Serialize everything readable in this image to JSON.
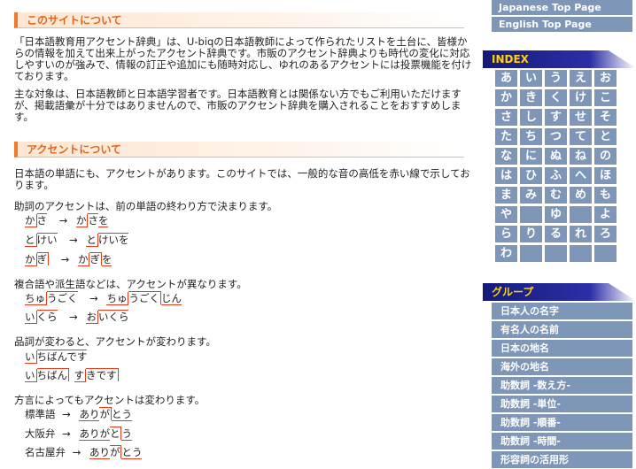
{
  "sections": {
    "about_title": "このサイトについて",
    "about_p1": "「日本語教育用アクセント辞典」は、U-biqの日本語教師によって作られたリストを土台に、皆様からの情報を加えて出来上がったアクセント辞典です。市販のアクセント辞典よりも時代の変化に対応しやすいのが強みで、情報の訂正や追加にも随時対応し、ゆれのあるアクセントには投票機能を付けております。",
    "about_p2": "主な対象は、日本語教師と日本語学習者です。日本語教育とは関係ない方でもご利用いただけますが、掲載語彙が十分ではありませんので、市販のアクセント辞典を購入されることをおすすめします。",
    "accent_title": "アクセントについて",
    "accent_p1": "日本語の単語にも、アクセントがあります。このサイトでは、一般的な音の高低を赤い線で示しております。",
    "particle_intro": "助詞のアクセントは、前の単語の終わり方で決まります。",
    "particle_examples": [
      {
        "a1": "か",
        "a2": "さ",
        "arrow": "→",
        "b1": "か",
        "b2": "さ",
        "b3": "を"
      },
      {
        "a1": "と",
        "a2": "けい",
        "arrow": "→",
        "b1": "と",
        "b2": "けい",
        "b3": "を"
      },
      {
        "a1": "か",
        "a2": "ぎ",
        "arrow": "→",
        "b1": "か",
        "b2": "ぎ",
        "b3": "を"
      }
    ],
    "compound_intro": "複合語や派生語などは、アクセントが異なります。",
    "compound_examples": [
      {
        "a1": "ちゅ",
        "a2": "うごく",
        "arrow": "→",
        "b1": "ちゅ",
        "b2": "うごく",
        "b3": "じん"
      },
      {
        "a1": "い",
        "a2": "くら",
        "arrow": "→",
        "b1": "お",
        "b2": "いくら",
        "b3": ""
      }
    ],
    "pos_intro": "品詞が変わると、アクセントが変わります。",
    "pos_examples": [
      {
        "a1": "い",
        "a2": "ちばんです"
      },
      {
        "a1": "い",
        "a2": "ちばん",
        "a3": "す",
        "a4": "きです"
      }
    ],
    "dialect_intro": "方言によってもアクセントは変わります。",
    "dialect_examples": [
      {
        "label": "標準語",
        "arrow": "→",
        "w1": "あり",
        "w2": "が",
        "w3": "とう"
      },
      {
        "label": "大阪弁",
        "arrow": "→",
        "w1": "ありが",
        "w2": "と",
        "w3": "う"
      },
      {
        "label": "名古屋弁",
        "arrow": "→",
        "w1": "あり",
        "w2": "が",
        "w3": "とう"
      }
    ]
  },
  "sidebar": {
    "links": [
      "Japanese Top Page",
      "English Top Page"
    ],
    "index_title": "INDEX",
    "kana_rows": [
      [
        "あ",
        "い",
        "う",
        "え",
        "お"
      ],
      [
        "か",
        "き",
        "く",
        "け",
        "こ"
      ],
      [
        "さ",
        "し",
        "す",
        "せ",
        "そ"
      ],
      [
        "た",
        "ち",
        "つ",
        "て",
        "と"
      ],
      [
        "な",
        "に",
        "ぬ",
        "ね",
        "の"
      ],
      [
        "は",
        "ひ",
        "ふ",
        "へ",
        "ほ"
      ],
      [
        "ま",
        "み",
        "む",
        "め",
        "も"
      ],
      [
        "や",
        "",
        "ゆ",
        "",
        "よ"
      ],
      [
        "ら",
        "り",
        "る",
        "れ",
        "ろ"
      ],
      [
        "わ",
        "",
        "",
        "",
        ""
      ]
    ],
    "group_title": "グループ",
    "group_items": [
      "日本人の名字",
      "有名人の名前",
      "日本の地名",
      "海外の地名",
      "助数詞 -数え方-",
      "助数詞 -単位-",
      "助数詞 -順番-",
      "助数詞 -時間-",
      "形容詞の活用形"
    ]
  }
}
